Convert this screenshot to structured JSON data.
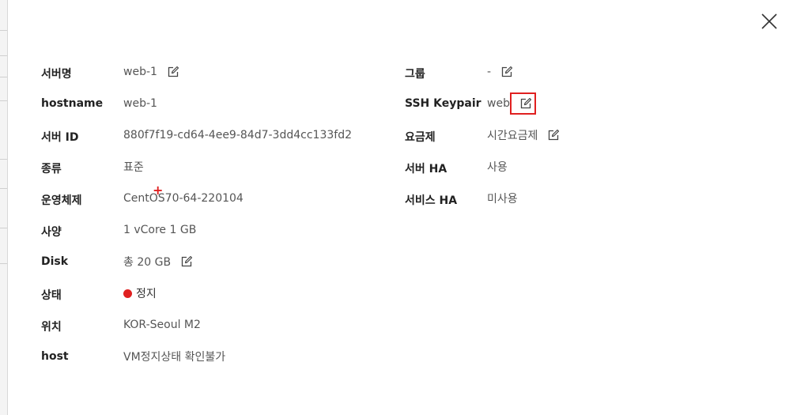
{
  "colors": {
    "label": "#222222",
    "value": "#555555",
    "status_stopped": "#e02020",
    "highlight": "#e02020"
  },
  "close_icon": "close-x-icon",
  "left_column": [
    {
      "key": "server_name",
      "label": "서버명",
      "value": "web-1",
      "editable": true
    },
    {
      "key": "hostname",
      "label": "hostname",
      "value": "web-1",
      "editable": false
    },
    {
      "key": "server_id",
      "label": "서버 ID",
      "value": "880f7f19-cd64-4ee9-84d7-3dd4cc133fd2",
      "editable": false
    },
    {
      "key": "type",
      "label": "종류",
      "value": "표준",
      "editable": false
    },
    {
      "key": "os",
      "label": "운영체제",
      "value": "CentOS70-64-220104",
      "editable": false
    },
    {
      "key": "spec",
      "label": "사양",
      "value": "1 vCore 1 GB",
      "editable": false
    },
    {
      "key": "disk",
      "label": "Disk",
      "value": "총 20 GB",
      "editable": true
    },
    {
      "key": "status",
      "label": "상태",
      "value": "정지",
      "editable": false,
      "status_color": "#e02020"
    },
    {
      "key": "location",
      "label": "위치",
      "value": "KOR-Seoul M2",
      "editable": false
    },
    {
      "key": "host",
      "label": "host",
      "value": "VM정지상태 확인불가",
      "editable": false
    }
  ],
  "right_column": [
    {
      "key": "group",
      "label": "그룹",
      "value": "-",
      "editable": true
    },
    {
      "key": "ssh_keypair",
      "label": "SSH Keypair",
      "value": "web",
      "editable": true,
      "highlighted": true
    },
    {
      "key": "plan",
      "label": "요금제",
      "value": "시간요금제",
      "editable": true
    },
    {
      "key": "server_ha",
      "label": "서버 HA",
      "value": "사용",
      "editable": false
    },
    {
      "key": "service_ha",
      "label": "서비스 HA",
      "value": "미사용",
      "editable": false
    }
  ],
  "cursor_glyph": "+",
  "cursor_color": "#e02020"
}
